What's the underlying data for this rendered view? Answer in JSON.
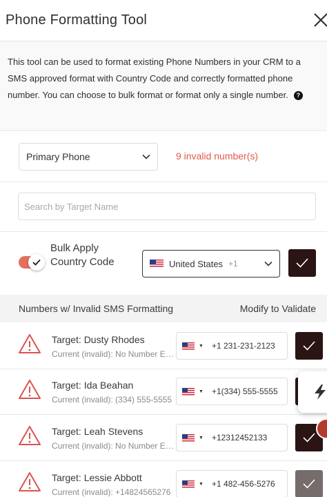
{
  "header": {
    "title": "Phone Formatting Tool"
  },
  "description": {
    "text": "This tool can be used to format existing Phone Numbers in your CRM to a SMS approved format with Country Code and correctly formatted phone number. You can choose to bulk format or format only a single number.",
    "help_icon_label": "?"
  },
  "filter": {
    "field_select": "Primary Phone",
    "invalid_count": "9 invalid number(s)"
  },
  "search": {
    "placeholder": "Search by Target Name"
  },
  "bulk": {
    "label": "Bulk Apply Country Code",
    "toggle_on": true,
    "country": "United States",
    "country_code": "+1"
  },
  "list_header": {
    "left": "Numbers w/ Invalid SMS Formatting",
    "right": "Modify to Validate"
  },
  "rows": [
    {
      "target": "Target: Dusty Rhodes",
      "current": "Current (invalid): No Number Exists",
      "phone": "+1 231-231-2123",
      "button_state": "active"
    },
    {
      "target": "Target: Ida Beahan",
      "current": "Current (invalid): (334) 555-5555",
      "phone": "+1(334) 555-5555",
      "button_state": "active"
    },
    {
      "target": "Target: Leah Stevens",
      "current": "Current (invalid): No Number Exists",
      "phone": "+12312452133",
      "button_state": "active"
    },
    {
      "target": "Target: Lessie Abbott",
      "current": "Current (invalid): +14824565276",
      "phone": "+1 482-456-5276",
      "button_state": "disabled"
    }
  ],
  "colors": {
    "accent": "#e2705f",
    "dark_button": "#2b1414",
    "disabled_button": "#756c6b",
    "invalid_text": "#e15b4c",
    "warning_icon": "#d9534f"
  },
  "icons": {
    "close": "close-icon",
    "help": "help-icon",
    "warning": "warning-triangle-icon",
    "check": "check-icon",
    "chevron": "chevron-down-icon",
    "flag": "us-flag-icon",
    "lightning": "lightning-icon"
  }
}
